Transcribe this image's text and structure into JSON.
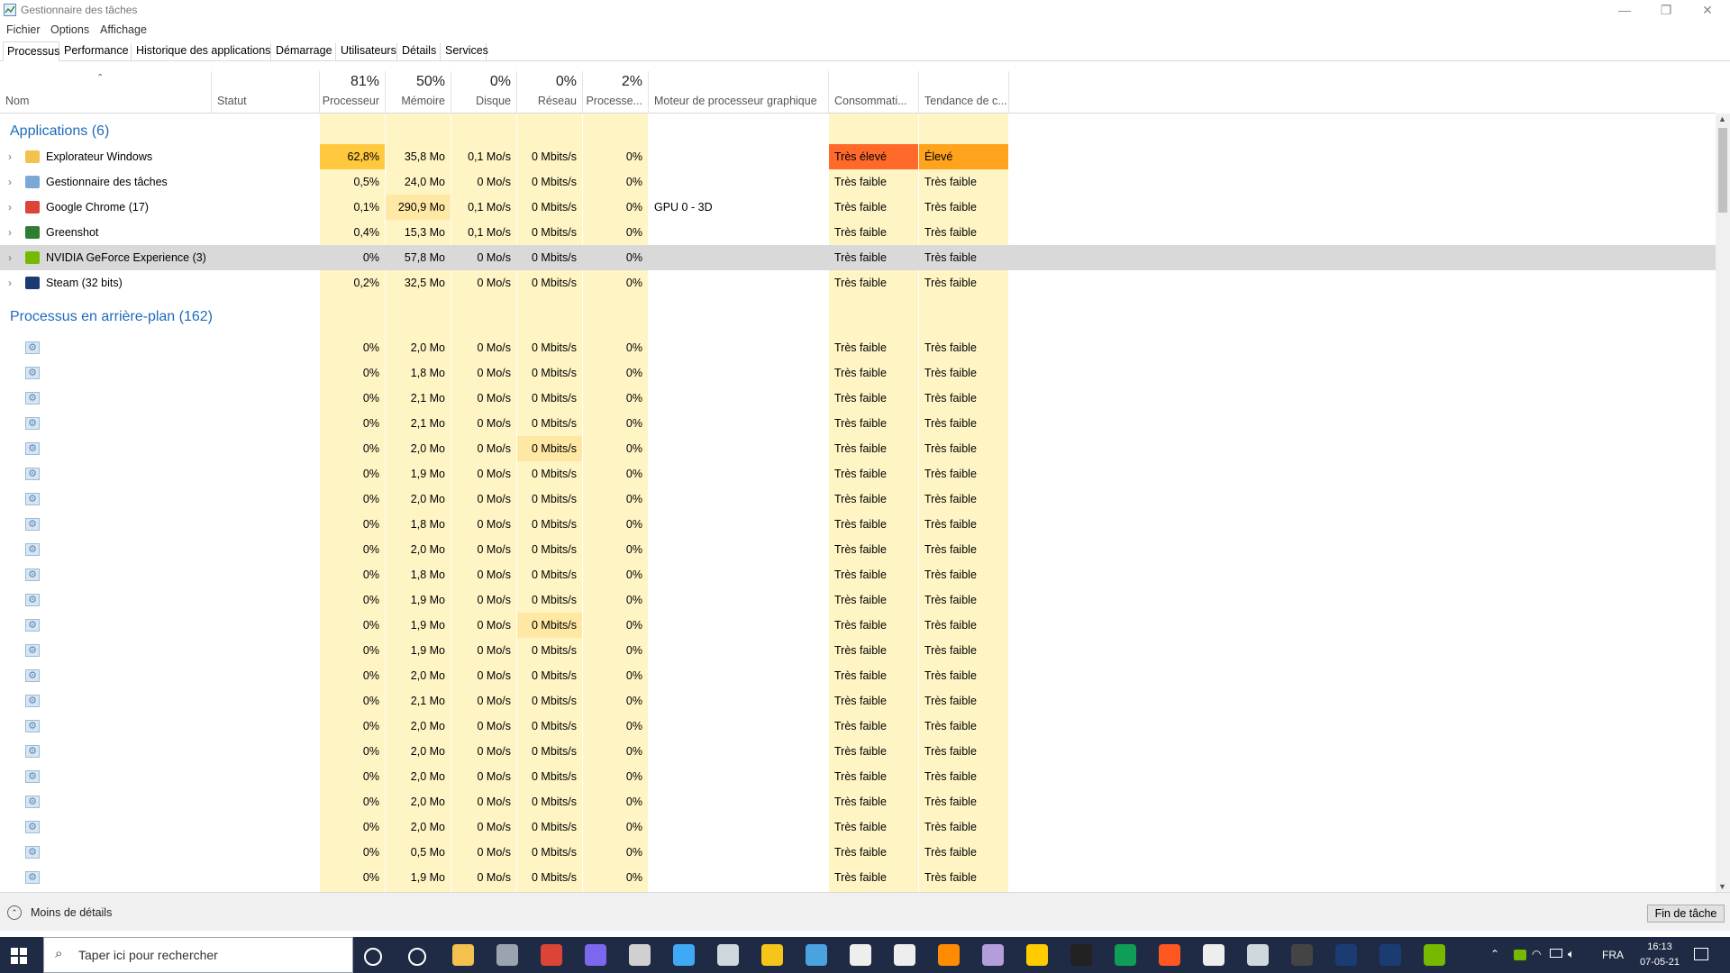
{
  "window": {
    "title": "Gestionnaire des tâches",
    "minimize": "—",
    "maximize": "❐",
    "close": "✕"
  },
  "menu": {
    "items": [
      "Fichier",
      "Options",
      "Affichage"
    ]
  },
  "tabs": [
    "Processus",
    "Performance",
    "Historique des applications",
    "Démarrage",
    "Utilisateurs",
    "Détails",
    "Services"
  ],
  "header": {
    "name": "Nom",
    "status": "Statut",
    "cpu": {
      "pct": "81%",
      "label": "Processeur"
    },
    "mem": {
      "pct": "50%",
      "label": "Mémoire"
    },
    "disk": {
      "pct": "0%",
      "label": "Disque"
    },
    "net": {
      "pct": "0%",
      "label": "Réseau"
    },
    "gpu": {
      "pct": "2%",
      "label": "Processe..."
    },
    "gpu_engine": "Moteur de processeur graphique",
    "power": "Consommati...",
    "power_trend": "Tendance de c..."
  },
  "groups": {
    "apps": "Applications (6)",
    "background": "Processus en arrière-plan (162)"
  },
  "apps": [
    {
      "name": "Explorateur Windows",
      "icon": "folder-icon",
      "cpu": "62,8%",
      "mem": "35,8 Mo",
      "disk": "0,1 Mo/s",
      "net": "0 Mbits/s",
      "gpu": "0%",
      "engine": "",
      "power": "Très élevé",
      "trend": "Élevé"
    },
    {
      "name": "Gestionnaire des tâches",
      "icon": "task-manager-icon",
      "cpu": "0,5%",
      "mem": "24,0 Mo",
      "disk": "0 Mo/s",
      "net": "0 Mbits/s",
      "gpu": "0%",
      "engine": "",
      "power": "Très faible",
      "trend": "Très faible"
    },
    {
      "name": "Google Chrome (17)",
      "icon": "chrome-icon",
      "cpu": "0,1%",
      "mem": "290,9 Mo",
      "disk": "0,1 Mo/s",
      "net": "0 Mbits/s",
      "gpu": "0%",
      "engine": "GPU 0 - 3D",
      "power": "Très faible",
      "trend": "Très faible"
    },
    {
      "name": "Greenshot",
      "icon": "greenshot-icon",
      "cpu": "0,4%",
      "mem": "15,3 Mo",
      "disk": "0,1 Mo/s",
      "net": "0 Mbits/s",
      "gpu": "0%",
      "engine": "",
      "power": "Très faible",
      "trend": "Très faible"
    },
    {
      "name": "NVIDIA GeForce Experience (3)",
      "icon": "nvidia-icon",
      "cpu": "0%",
      "mem": "57,8 Mo",
      "disk": "0 Mo/s",
      "net": "0 Mbits/s",
      "gpu": "0%",
      "engine": "",
      "power": "Très faible",
      "trend": "Très faible"
    },
    {
      "name": "Steam (32 bits)",
      "icon": "steam-icon",
      "cpu": "0,2%",
      "mem": "32,5 Mo",
      "disk": "0 Mo/s",
      "net": "0 Mbits/s",
      "gpu": "0%",
      "engine": "",
      "power": "Très faible",
      "trend": "Très faible"
    }
  ],
  "background": [
    {
      "cpu": "0%",
      "mem": "2,0 Mo",
      "disk": "0 Mo/s",
      "net": "0 Mbits/s",
      "gpu": "0%",
      "power": "Très faible",
      "trend": "Très faible"
    },
    {
      "cpu": "0%",
      "mem": "1,8 Mo",
      "disk": "0 Mo/s",
      "net": "0 Mbits/s",
      "gpu": "0%",
      "power": "Très faible",
      "trend": "Très faible"
    },
    {
      "cpu": "0%",
      "mem": "2,1 Mo",
      "disk": "0 Mo/s",
      "net": "0 Mbits/s",
      "gpu": "0%",
      "power": "Très faible",
      "trend": "Très faible"
    },
    {
      "cpu": "0%",
      "mem": "2,1 Mo",
      "disk": "0 Mo/s",
      "net": "0 Mbits/s",
      "gpu": "0%",
      "power": "Très faible",
      "trend": "Très faible"
    },
    {
      "cpu": "0%",
      "mem": "2,0 Mo",
      "disk": "0 Mo/s",
      "net": "0 Mbits/s",
      "gpu": "0%",
      "power": "Très faible",
      "trend": "Très faible"
    },
    {
      "cpu": "0%",
      "mem": "1,9 Mo",
      "disk": "0 Mo/s",
      "net": "0 Mbits/s",
      "gpu": "0%",
      "power": "Très faible",
      "trend": "Très faible"
    },
    {
      "cpu": "0%",
      "mem": "2,0 Mo",
      "disk": "0 Mo/s",
      "net": "0 Mbits/s",
      "gpu": "0%",
      "power": "Très faible",
      "trend": "Très faible"
    },
    {
      "cpu": "0%",
      "mem": "1,8 Mo",
      "disk": "0 Mo/s",
      "net": "0 Mbits/s",
      "gpu": "0%",
      "power": "Très faible",
      "trend": "Très faible"
    },
    {
      "cpu": "0%",
      "mem": "2,0 Mo",
      "disk": "0 Mo/s",
      "net": "0 Mbits/s",
      "gpu": "0%",
      "power": "Très faible",
      "trend": "Très faible"
    },
    {
      "cpu": "0%",
      "mem": "1,8 Mo",
      "disk": "0 Mo/s",
      "net": "0 Mbits/s",
      "gpu": "0%",
      "power": "Très faible",
      "trend": "Très faible"
    },
    {
      "cpu": "0%",
      "mem": "1,9 Mo",
      "disk": "0 Mo/s",
      "net": "0 Mbits/s",
      "gpu": "0%",
      "power": "Très faible",
      "trend": "Très faible"
    },
    {
      "cpu": "0%",
      "mem": "1,9 Mo",
      "disk": "0 Mo/s",
      "net": "0 Mbits/s",
      "gpu": "0%",
      "power": "Très faible",
      "trend": "Très faible"
    },
    {
      "cpu": "0%",
      "mem": "1,9 Mo",
      "disk": "0 Mo/s",
      "net": "0 Mbits/s",
      "gpu": "0%",
      "power": "Très faible",
      "trend": "Très faible"
    },
    {
      "cpu": "0%",
      "mem": "2,0 Mo",
      "disk": "0 Mo/s",
      "net": "0 Mbits/s",
      "gpu": "0%",
      "power": "Très faible",
      "trend": "Très faible"
    },
    {
      "cpu": "0%",
      "mem": "2,1 Mo",
      "disk": "0 Mo/s",
      "net": "0 Mbits/s",
      "gpu": "0%",
      "power": "Très faible",
      "trend": "Très faible"
    },
    {
      "cpu": "0%",
      "mem": "2,0 Mo",
      "disk": "0 Mo/s",
      "net": "0 Mbits/s",
      "gpu": "0%",
      "power": "Très faible",
      "trend": "Très faible"
    },
    {
      "cpu": "0%",
      "mem": "2,0 Mo",
      "disk": "0 Mo/s",
      "net": "0 Mbits/s",
      "gpu": "0%",
      "power": "Très faible",
      "trend": "Très faible"
    },
    {
      "cpu": "0%",
      "mem": "2,0 Mo",
      "disk": "0 Mo/s",
      "net": "0 Mbits/s",
      "gpu": "0%",
      "power": "Très faible",
      "trend": "Très faible"
    },
    {
      "cpu": "0%",
      "mem": "2,0 Mo",
      "disk": "0 Mo/s",
      "net": "0 Mbits/s",
      "gpu": "0%",
      "power": "Très faible",
      "trend": "Très faible"
    },
    {
      "cpu": "0%",
      "mem": "2,0 Mo",
      "disk": "0 Mo/s",
      "net": "0 Mbits/s",
      "gpu": "0%",
      "power": "Très faible",
      "trend": "Très faible"
    },
    {
      "cpu": "0%",
      "mem": "0,5 Mo",
      "disk": "0 Mo/s",
      "net": "0 Mbits/s",
      "gpu": "0%",
      "power": "Très faible",
      "trend": "Très faible"
    },
    {
      "cpu": "0%",
      "mem": "1,9 Mo",
      "disk": "0 Mo/s",
      "net": "0 Mbits/s",
      "gpu": "0%",
      "power": "Très faible",
      "trend": "Très faible"
    }
  ],
  "footer": {
    "less_details": "Moins de détails",
    "end_task": "Fin de tâche"
  },
  "taskbar": {
    "search_placeholder": "Taper ici pour rechercher",
    "lang": "FRA",
    "time": "16:13",
    "date": "07-05-21",
    "apps": [
      "cortana-icon",
      "task-view-icon",
      "file-explorer-icon",
      "app-icon",
      "chrome-icon",
      "app-icon",
      "app-icon",
      "app-icon",
      "settings-icon",
      "rockstar-icon",
      "app-icon",
      "file-icon",
      "file-icon",
      "app-icon",
      "app-icon",
      "app-icon",
      "terminal-icon",
      "app-icon",
      "app-icon",
      "app-icon",
      "app-icon",
      "app-icon",
      "steam-icon",
      "steam-icon",
      "nvidia-icon"
    ]
  },
  "colors": {
    "heat_light": "#fff4c4",
    "heat_mid": "#ffe8a3",
    "heat_high": "#ffc83d",
    "power_very_high": "#ff6a2a",
    "power_high": "#ffa21c",
    "group_blue": "#1e6ab8"
  }
}
